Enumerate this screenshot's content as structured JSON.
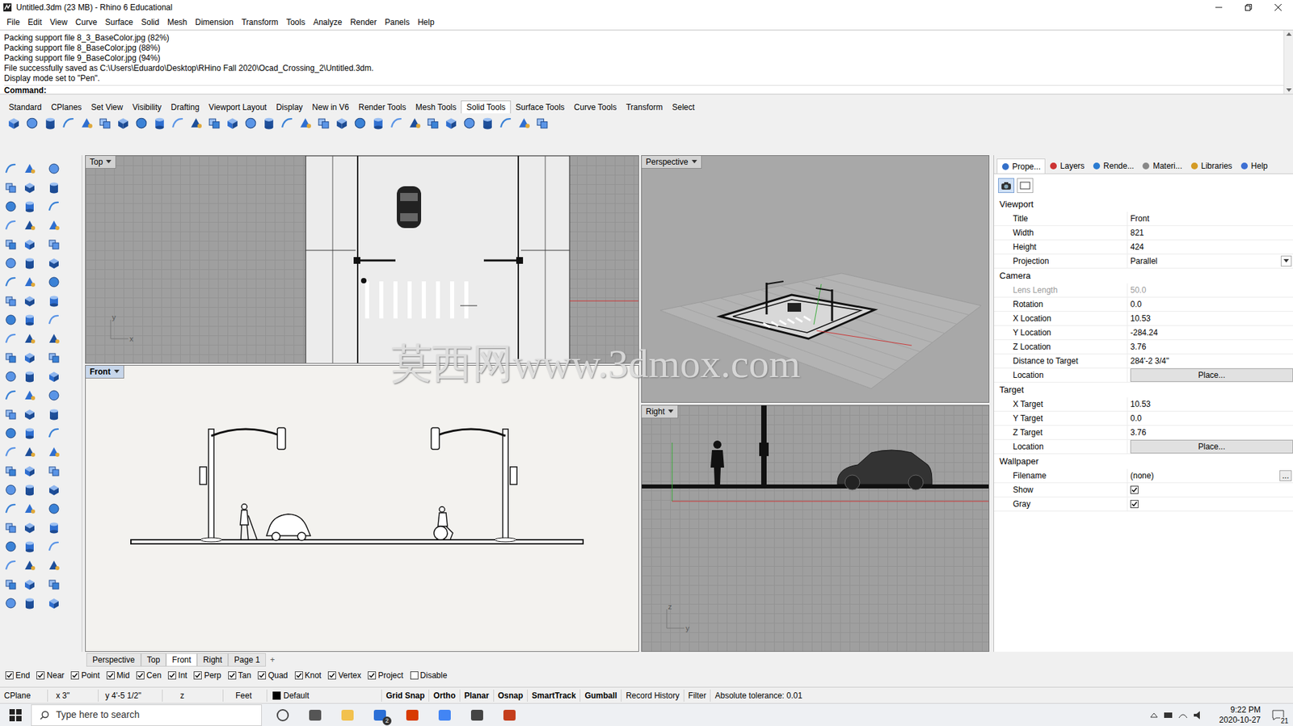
{
  "window": {
    "title": "Untitled.3dm (23 MB) - Rhino 6 Educational"
  },
  "menu": [
    "File",
    "Edit",
    "View",
    "Curve",
    "Surface",
    "Solid",
    "Mesh",
    "Dimension",
    "Transform",
    "Tools",
    "Analyze",
    "Render",
    "Panels",
    "Help"
  ],
  "command_history": [
    "Packing support file 8_3_BaseColor.jpg (82%)",
    "Packing support file 8_BaseColor.jpg (88%)",
    "Packing support file 9_BaseColor.jpg (94%)",
    "File successfully saved as C:\\Users\\Eduardo\\Desktop\\RHino Fall 2020\\Ocad_Crossing_2\\Untitled.3dm.",
    "Display mode set to \"Pen\"."
  ],
  "command_prompt": "Command:",
  "toolbar_tabs": [
    {
      "label": "Standard",
      "selected": false
    },
    {
      "label": "CPlanes",
      "selected": false
    },
    {
      "label": "Set View",
      "selected": false
    },
    {
      "label": "Visibility",
      "selected": false
    },
    {
      "label": "Drafting",
      "selected": false
    },
    {
      "label": "Viewport Layout",
      "selected": false
    },
    {
      "label": "Display",
      "selected": false
    },
    {
      "label": "New in V6",
      "selected": false
    },
    {
      "label": "Render Tools",
      "selected": false
    },
    {
      "label": "Mesh Tools",
      "selected": false
    },
    {
      "label": "Solid Tools",
      "selected": true
    },
    {
      "label": "Surface Tools",
      "selected": false
    },
    {
      "label": "Curve Tools",
      "selected": false
    },
    {
      "label": "Transform",
      "selected": false
    },
    {
      "label": "Select",
      "selected": false
    }
  ],
  "viewports": {
    "top": {
      "title": "Top",
      "active": false,
      "axes": [
        "y",
        "x"
      ]
    },
    "perspective": {
      "title": "Perspective",
      "active": false,
      "axes": []
    },
    "front": {
      "title": "Front",
      "active": true,
      "axes": []
    },
    "right": {
      "title": "Right",
      "active": false,
      "axes": [
        "z",
        "y"
      ]
    }
  },
  "viewport_tabs": [
    {
      "label": "Perspective",
      "selected": false
    },
    {
      "label": "Top",
      "selected": false
    },
    {
      "label": "Front",
      "selected": true
    },
    {
      "label": "Right",
      "selected": false
    },
    {
      "label": "Page 1",
      "selected": false
    }
  ],
  "add_tab": "+",
  "watermark": "莫西网www.3dmox.com",
  "panel": {
    "tabs": [
      {
        "label": "Prope...",
        "selected": true
      },
      {
        "label": "Layers",
        "selected": false
      },
      {
        "label": "Rende...",
        "selected": false
      },
      {
        "label": "Materi...",
        "selected": false
      },
      {
        "label": "Libraries",
        "selected": false
      },
      {
        "label": "Help",
        "selected": false
      }
    ],
    "sections": [
      {
        "title": "Viewport",
        "rows": [
          {
            "label": "Title",
            "value": "Front",
            "kind": "text",
            "disabled": false
          },
          {
            "label": "Width",
            "value": "821",
            "kind": "text",
            "disabled": false
          },
          {
            "label": "Height",
            "value": "424",
            "kind": "text",
            "disabled": false
          },
          {
            "label": "Projection",
            "value": "Parallel",
            "kind": "dropdown",
            "disabled": false
          }
        ]
      },
      {
        "title": "Camera",
        "rows": [
          {
            "label": "Lens Length",
            "value": "50.0",
            "kind": "text",
            "disabled": true
          },
          {
            "label": "Rotation",
            "value": "0.0",
            "kind": "text",
            "disabled": false
          },
          {
            "label": "X Location",
            "value": "10.53",
            "kind": "text",
            "disabled": false
          },
          {
            "label": "Y Location",
            "value": "-284.24",
            "kind": "text",
            "disabled": false
          },
          {
            "label": "Z Location",
            "value": "3.76",
            "kind": "text",
            "disabled": false
          },
          {
            "label": "Distance to Target",
            "value": "284'-2 3/4\"",
            "kind": "text",
            "disabled": false
          },
          {
            "label": "Location",
            "value": "Place...",
            "kind": "button",
            "disabled": false
          }
        ]
      },
      {
        "title": "Target",
        "rows": [
          {
            "label": "X Target",
            "value": "10.53",
            "kind": "text",
            "disabled": false
          },
          {
            "label": "Y Target",
            "value": "0.0",
            "kind": "text",
            "disabled": false
          },
          {
            "label": "Z Target",
            "value": "3.76",
            "kind": "text",
            "disabled": false
          },
          {
            "label": "Location",
            "value": "Place...",
            "kind": "button",
            "disabled": false
          }
        ]
      },
      {
        "title": "Wallpaper",
        "rows": [
          {
            "label": "Filename",
            "value": "(none)",
            "button": "...",
            "kind": "file",
            "disabled": false
          },
          {
            "label": "Show",
            "checked": true,
            "kind": "checkbox",
            "disabled": false
          },
          {
            "label": "Gray",
            "checked": true,
            "kind": "checkbox",
            "disabled": false
          }
        ]
      }
    ]
  },
  "osnaps": [
    {
      "label": "End",
      "checked": true
    },
    {
      "label": "Near",
      "checked": true
    },
    {
      "label": "Point",
      "checked": true
    },
    {
      "label": "Mid",
      "checked": true
    },
    {
      "label": "Cen",
      "checked": true
    },
    {
      "label": "Int",
      "checked": true
    },
    {
      "label": "Perp",
      "checked": true
    },
    {
      "label": "Tan",
      "checked": true
    },
    {
      "label": "Quad",
      "checked": true
    },
    {
      "label": "Knot",
      "checked": true
    },
    {
      "label": "Vertex",
      "checked": true
    },
    {
      "label": "Project",
      "checked": true
    },
    {
      "label": "Disable",
      "checked": false
    }
  ],
  "status_bar": {
    "cplane": "CPlane",
    "x": "x 3\"",
    "y": "y 4'-5 1/2\"",
    "z": "z",
    "units": "Feet",
    "layer": {
      "name": "Default",
      "color": "#000000"
    },
    "toggles": [
      {
        "label": "Grid Snap",
        "on": true
      },
      {
        "label": "Ortho",
        "on": true
      },
      {
        "label": "Planar",
        "on": true
      },
      {
        "label": "Osnap",
        "on": true
      },
      {
        "label": "SmartTrack",
        "on": true
      },
      {
        "label": "Gumball",
        "on": true
      },
      {
        "label": "Record History",
        "on": false
      },
      {
        "label": "Filter",
        "on": false
      }
    ],
    "tolerance": "Absolute tolerance: 0.01"
  },
  "taskbar": {
    "search": "Type here to search",
    "mail_badge": "2",
    "time": "9:22 PM",
    "date": "2020-10-27",
    "notifications": "21"
  }
}
